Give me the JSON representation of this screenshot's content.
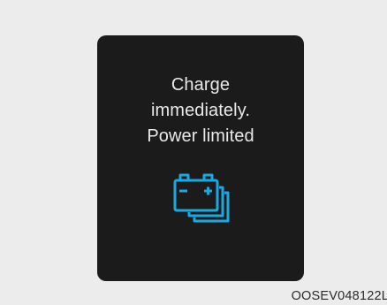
{
  "display": {
    "message_lines": [
      "Charge",
      "immediately.",
      "Power limited"
    ],
    "icon": "multiple-battery-icon",
    "icon_color": "#1aa8e0",
    "background_color": "#1c1b1c",
    "text_color": "#e9e9e9"
  },
  "figure": {
    "reference_code": "OOSEV048122L"
  }
}
